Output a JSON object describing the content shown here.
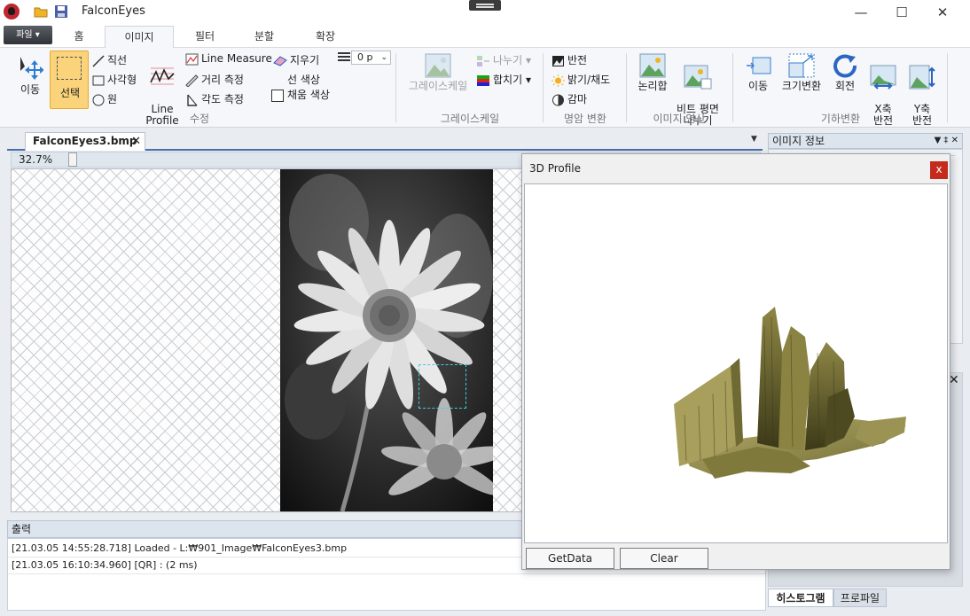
{
  "app": {
    "title": "FalconEyes"
  },
  "tabs": {
    "file": "파일 ▾",
    "items": [
      "홈",
      "이미지",
      "필터",
      "분할",
      "확장"
    ],
    "active": "이미지"
  },
  "ribbon": {
    "edit": {
      "move": "이동",
      "select": "선택",
      "line": "직선",
      "rect": "사각형",
      "circle": "원",
      "line_profile": "Line\nProfile",
      "line_measure": "Line Measure",
      "distance": "거리 측정",
      "angle": "각도 측정",
      "eraser": "지우기",
      "line_color": "선 색상",
      "fill_color": "채움 색상",
      "pen_size": "0 p",
      "group": "수정"
    },
    "grayscale": {
      "button": "그레이스케일",
      "split": "나누기",
      "merge": "합치기",
      "group": "그레이스케일"
    },
    "tone": {
      "invert": "반전",
      "brightness": "밝기/채도",
      "gamma": "감마",
      "group": "명암 변환"
    },
    "ops": {
      "logic": "논리합",
      "bitplane": "비트 평면\n나누기",
      "group": "이미지 연산"
    },
    "geometry": {
      "move": "이동",
      "resize": "크기변환",
      "rotate": "회전",
      "flipx": "X축\n반전",
      "flipy": "Y축\n반전",
      "group": "기하변환"
    }
  },
  "document": {
    "tab": "FalconEyes3.bmp",
    "zoom": "32.7%",
    "zoom_fraction": 0.05
  },
  "output": {
    "title": "출력",
    "lines": [
      "[21.03.05 14:55:28.718] Loaded - L:₩901_Image₩FalconEyes3.bmp",
      "[21.03.05 16:10:34.960] [QR]  :  (2 ms)"
    ]
  },
  "right_panel": {
    "title": "이미지 정보",
    "tabs": [
      "히스토그램",
      "프로파일"
    ],
    "active_tab": "히스토그램"
  },
  "dialog": {
    "title": "3D Profile",
    "close": "x",
    "buttons": [
      "GetData",
      "Clear"
    ]
  },
  "colors": {
    "accent": "#4a6da7",
    "select_highlight": "#fbd37a",
    "surface": "#a8a05a",
    "close_red": "#c42b1c"
  }
}
